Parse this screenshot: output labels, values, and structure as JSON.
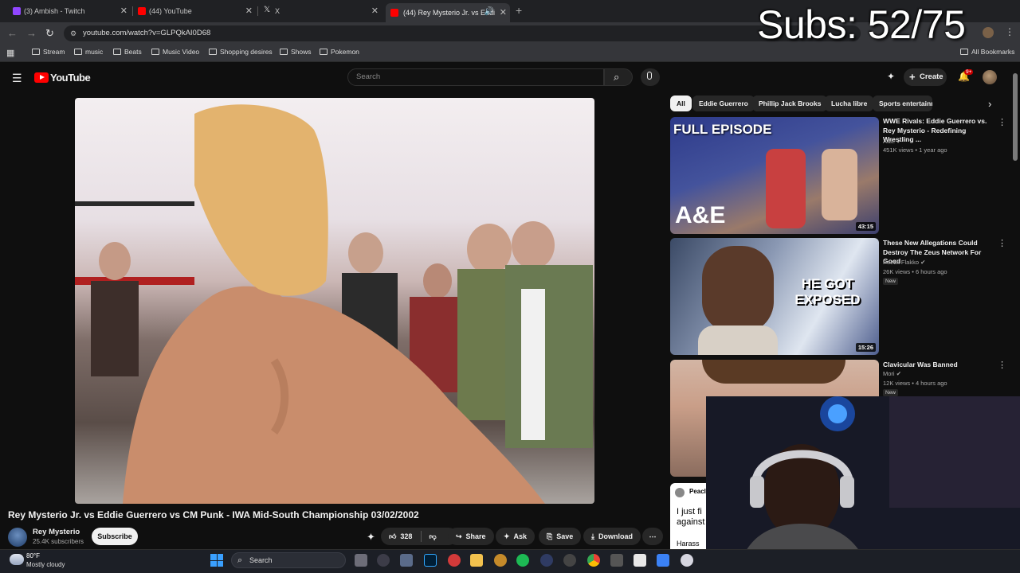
{
  "browser": {
    "tabs": [
      {
        "label": "(3) Ambish - Twitch",
        "favicon_color": "#9146ff"
      },
      {
        "label": "(44) YouTube",
        "favicon_color": "#ff0000"
      },
      {
        "label": "X",
        "favicon_color": "#000000"
      },
      {
        "label": "(44) Rey Mysterio Jr. vs Eddi",
        "favicon_color": "#ff0000"
      }
    ],
    "new_tab": "+",
    "url": "youtube.com/watch?v=GLPQkAI0D68",
    "bookmarks": [
      "Stream",
      "music",
      "Beats",
      "Music Video",
      "Shopping desires",
      "Shows",
      "Pokemon"
    ],
    "all_bookmarks": "All Bookmarks"
  },
  "overlay": {
    "subs": "Subs: 52/75"
  },
  "youtube": {
    "logo": "YouTube",
    "search_placeholder": "Search",
    "create": "Create",
    "notifications": "9+",
    "chips": [
      "All",
      "Eddie Guerrero",
      "Phillip Jack Brooks",
      "Lucha libre",
      "Sports entertainm"
    ],
    "video": {
      "title": "Rey Mysterio Jr. vs Eddie Guerrero vs CM Punk - IWA Mid-South Championship 03/02/2002",
      "channel": "Rey Mysterio",
      "subscribers": "25.4K subscribers",
      "subscribe": "Subscribe",
      "likes": "328",
      "share": "Share",
      "ask": "Ask",
      "save": "Save",
      "download": "Download"
    },
    "recommendations": [
      {
        "title": "WWE Rivals: Eddie Guerrero vs. Rey Mysterio - Redefining Wrestling ...",
        "channel": "A&E",
        "meta": "451K views • 1 year ago",
        "duration": "43:15",
        "thumb_text": "FULL EPISODE",
        "thumb_brand": "A&E"
      },
      {
        "title": "These New Allegations Could Destroy The Zeus Network For Good",
        "channel": "Poetik Flakko",
        "meta": "26K views • 6 hours ago",
        "duration": "15:26",
        "badge": "New",
        "thumb_text": "HE GOT EXPOSED"
      },
      {
        "title": "Clavicular Was Banned",
        "channel": "Mori",
        "meta": "12K views • 4 hours ago",
        "badge": "New"
      }
    ],
    "partial_card": {
      "line1": "Peacl",
      "line2": "I just fi",
      "line3": "against",
      "line4": "Harass"
    }
  },
  "taskbar": {
    "temp": "80°F",
    "weather": "Mostly cloudy",
    "search": "Search"
  }
}
